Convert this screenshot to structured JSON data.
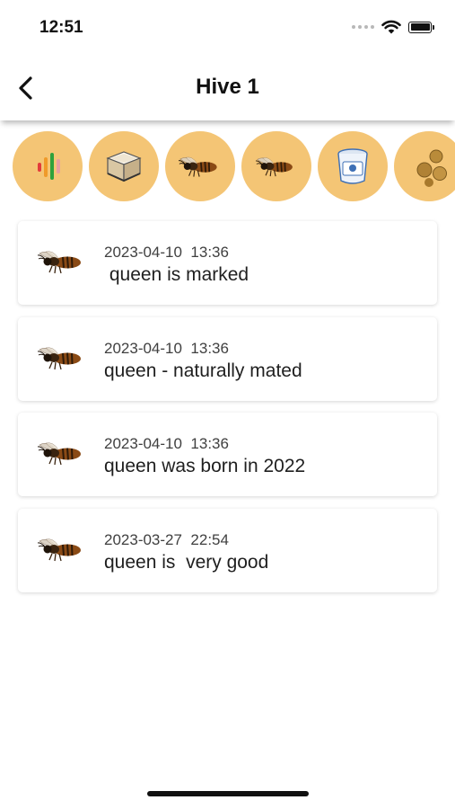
{
  "status_bar": {
    "time": "12:51",
    "wifi_icon": "wifi-icon",
    "battery_icon": "battery-full-icon"
  },
  "header": {
    "title": "Hive 1",
    "back_icon": "chevron-left-icon"
  },
  "category_icons": [
    {
      "icon": "audio-level-icon"
    },
    {
      "icon": "hive-box-icon"
    },
    {
      "icon": "worker-bees-icon"
    },
    {
      "icon": "queen-bee-icon"
    },
    {
      "icon": "feeder-jar-icon"
    },
    {
      "icon": "pollen-balls-icon"
    }
  ],
  "entries": [
    {
      "date": "2023-04-10",
      "time": "13:36",
      "text": "queen is marked"
    },
    {
      "date": "2023-04-10",
      "time": "13:36",
      "text": "queen - naturally mated"
    },
    {
      "date": "2023-04-10",
      "time": "13:36",
      "text": "queen was born in 2022"
    },
    {
      "date": "2023-03-27",
      "time": "22:54",
      "text": "queen is  very good"
    }
  ],
  "colors": {
    "accent": "#f4c575",
    "background": "#ffffff",
    "card_shadow": "#d0d0d0"
  }
}
